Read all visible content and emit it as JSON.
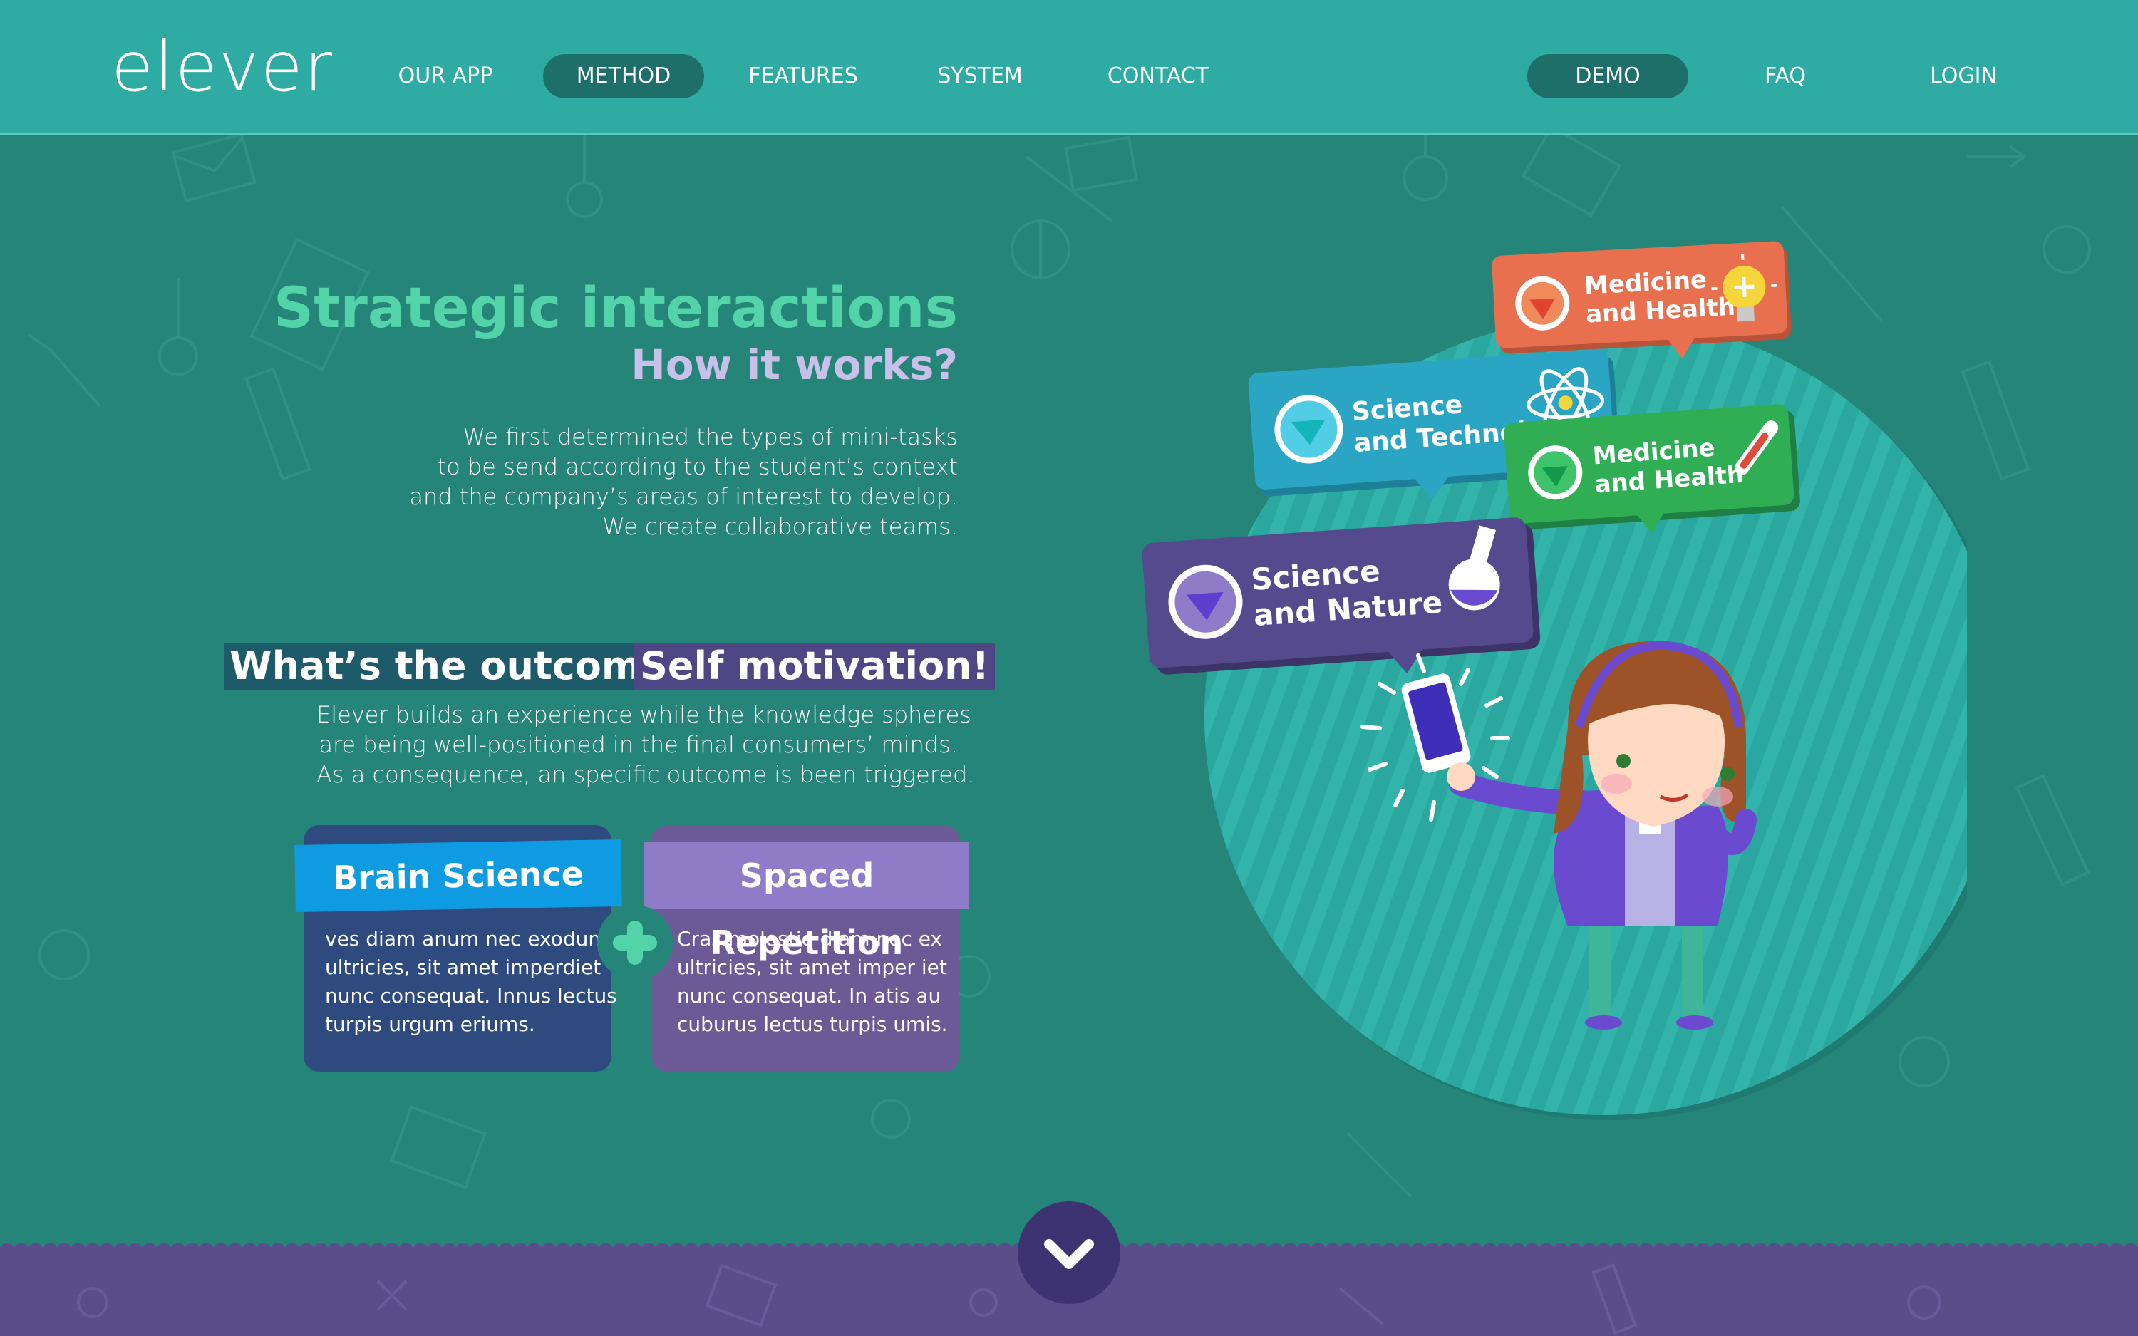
{
  "logo": "elever",
  "nav": {
    "items": [
      "OUR APP",
      "METHOD",
      "FEATURES",
      "SYSTEM",
      "CONTACT"
    ],
    "right": [
      "DEMO",
      "FAQ",
      "LOGIN"
    ],
    "active": "METHOD"
  },
  "hero": {
    "title": "Strategic interactions",
    "subtitle": "How it works?",
    "paragraph": [
      "We first determined the types of mini-tasks",
      "to be send according to the student’s context",
      "and the company’s areas of interest to develop.",
      "We create collaborative teams."
    ]
  },
  "outcome": {
    "question": "What’s the outcome?",
    "answer": "Self motivation!",
    "paragraph": [
      "Elever builds an experience while the knowledge spheres",
      "are being well-positioned in the final consumers’ minds.",
      "As a consequence, an specific outcome is been triggered."
    ]
  },
  "cards": [
    {
      "title": "Brain Science",
      "lines": [
        "ves diam anum nec exodum",
        "ultricies, sit amet imperdiet",
        "nunc consequat. Innus lectus",
        "turpis urgum eriums."
      ],
      "color": "#2f4a7e",
      "header_color": "#0e9be2"
    },
    {
      "title": "Spaced Repetition",
      "lines": [
        "Cras molestie diam nec ex",
        "ultricies, sit amet imper iet",
        "nunc consequat. In atis au",
        "cuburus lectus turpis umis."
      ],
      "color": "#6c5a96",
      "header_color": "#8f7cc8"
    }
  ],
  "bubbles": [
    {
      "line1": "Medicine",
      "line2": "and Health",
      "color": "#e8704e",
      "icon": "lightbulb-icon"
    },
    {
      "line1": "Science",
      "line2": "and Technology",
      "color": "#2aa6c4",
      "icon": "atom-icon"
    },
    {
      "line1": "Medicine",
      "line2": "and Health",
      "color": "#2fae53",
      "icon": "thermometer-icon"
    },
    {
      "line1": "Science",
      "line2": "and Nature",
      "color": "#564a8f",
      "icon": "flask-icon"
    }
  ],
  "colors": {
    "nav_bg": "#2eaca4",
    "page_bg": "#268579",
    "accent_green": "#53d3a8",
    "accent_lavender": "#c9c0ea",
    "bottom_bg": "#5a4e8a"
  },
  "icons": {
    "scroll": "chevron-down-icon",
    "plus": "plus-icon",
    "gem": "diamond-icon"
  }
}
